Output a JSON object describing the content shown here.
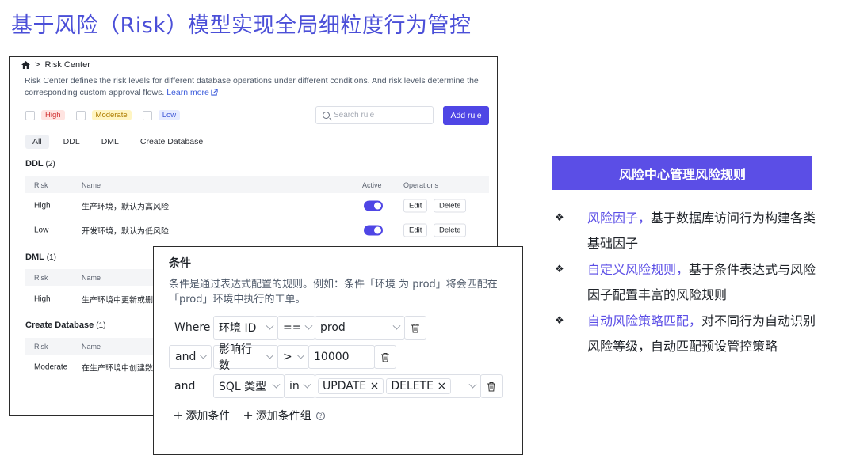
{
  "slide": {
    "title": "基于风险（Risk）模型实现全局细粒度行为管控"
  },
  "risk_center": {
    "breadcrumb": {
      "separator": ">",
      "current": "Risk Center"
    },
    "description": "Risk Center defines the risk levels for different database operations under different conditions. And risk levels determine the corresponding custom approval flows.",
    "learn_more": "Learn more",
    "levels": [
      "High",
      "Moderate",
      "Low"
    ],
    "search_placeholder": "Search rule",
    "add_rule": "Add rule",
    "tabs": [
      "All",
      "DDL",
      "DML",
      "Create Database"
    ],
    "columns": {
      "risk": "Risk",
      "name": "Name",
      "active": "Active",
      "operations": "Operations"
    },
    "edit": "Edit",
    "delete": "Delete",
    "sections": [
      {
        "title": "DDL",
        "count": "(2)",
        "rows": [
          {
            "risk": "High",
            "name": "生产环境，默认为高风险"
          },
          {
            "risk": "Low",
            "name": "开发环境，默认为低风险"
          }
        ]
      },
      {
        "title": "DML",
        "count": "(1)",
        "rows": [
          {
            "risk": "High",
            "name": "生产环境中更新或删"
          }
        ]
      },
      {
        "title": "Create Database",
        "count": "(1)",
        "rows": [
          {
            "risk": "Moderate",
            "name": "在生产环境中创建数"
          }
        ]
      }
    ],
    "colors": {
      "accent": "#4f46e5"
    }
  },
  "condition": {
    "title": "条件",
    "description": "条件是通过表达式配置的规则。例如：条件「环境 为 prod」将会匹配在「prod」环境中执行的工单。",
    "rows": [
      {
        "keyword": "Where",
        "field": "环境 ID",
        "op": "==",
        "value": "prod"
      },
      {
        "keyword": "and",
        "field": "影响行数",
        "op": ">",
        "value": "10000"
      },
      {
        "keyword": "and",
        "field": "SQL 类型",
        "op": "in",
        "chips": [
          "UPDATE",
          "DELETE"
        ]
      }
    ],
    "add_condition": "添加条件",
    "add_group": "添加条件组",
    "help": "?"
  },
  "features": {
    "header": "风险中心管理风险规则",
    "bullet_symbol": "❖",
    "items": [
      {
        "highlight": "风险因子，",
        "text": "基于数据库访问行为构建各类基础因子"
      },
      {
        "highlight": "自定义风险规则，",
        "text": "基于条件表达式与风险因子配置丰富的风险规则"
      },
      {
        "highlight": "自动风险策略匹配，",
        "text": "对不同行为自动识别风险等级，自动匹配预设管控策略"
      }
    ],
    "colors": {
      "highlight": "#5b4ee6",
      "header_bg": "#5b4ee6"
    }
  }
}
